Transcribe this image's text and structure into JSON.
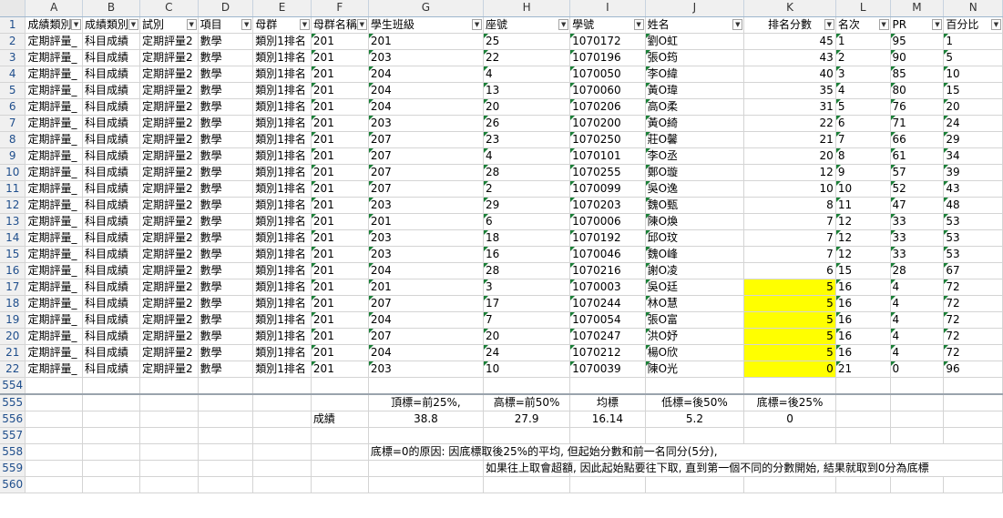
{
  "column_letters": [
    "A",
    "B",
    "C",
    "D",
    "E",
    "F",
    "G",
    "H",
    "I",
    "J",
    "K",
    "L",
    "M",
    "N"
  ],
  "headers": [
    "成績類別",
    "成績類別",
    "試別",
    "項目",
    "母群",
    "母群名稱",
    "學生班級",
    "座號",
    "學號",
    "姓名",
    "排名分數",
    "名次",
    "PR",
    "百分比"
  ],
  "rows": [
    {
      "n": "2",
      "a": "定期評量_",
      "b": "科目成績",
      "c": "定期評量2",
      "d": "數學",
      "e": "類別1排名",
      "f": "201",
      "g": "201",
      "h": "25",
      "i": "1070172",
      "j": "劉O虹",
      "k": "45",
      "l": "1",
      "m": "95",
      "o": "1",
      "hl": false
    },
    {
      "n": "3",
      "a": "定期評量_",
      "b": "科目成績",
      "c": "定期評量2",
      "d": "數學",
      "e": "類別1排名",
      "f": "201",
      "g": "203",
      "h": "22",
      "i": "1070196",
      "j": "張O筠",
      "k": "43",
      "l": "2",
      "m": "90",
      "o": "5",
      "hl": false
    },
    {
      "n": "4",
      "a": "定期評量_",
      "b": "科目成績",
      "c": "定期評量2",
      "d": "數學",
      "e": "類別1排名",
      "f": "201",
      "g": "204",
      "h": "4",
      "i": "1070050",
      "j": "李O緯",
      "k": "40",
      "l": "3",
      "m": "85",
      "o": "10",
      "hl": false
    },
    {
      "n": "5",
      "a": "定期評量_",
      "b": "科目成績",
      "c": "定期評量2",
      "d": "數學",
      "e": "類別1排名",
      "f": "201",
      "g": "204",
      "h": "13",
      "i": "1070060",
      "j": "黃O瑋",
      "k": "35",
      "l": "4",
      "m": "80",
      "o": "15",
      "hl": false
    },
    {
      "n": "6",
      "a": "定期評量_",
      "b": "科目成績",
      "c": "定期評量2",
      "d": "數學",
      "e": "類別1排名",
      "f": "201",
      "g": "204",
      "h": "20",
      "i": "1070206",
      "j": "高O柔",
      "k": "31",
      "l": "5",
      "m": "76",
      "o": "20",
      "hl": false
    },
    {
      "n": "7",
      "a": "定期評量_",
      "b": "科目成績",
      "c": "定期評量2",
      "d": "數學",
      "e": "類別1排名",
      "f": "201",
      "g": "203",
      "h": "26",
      "i": "1070200",
      "j": "黃O綺",
      "k": "22",
      "l": "6",
      "m": "71",
      "o": "24",
      "hl": false
    },
    {
      "n": "8",
      "a": "定期評量_",
      "b": "科目成績",
      "c": "定期評量2",
      "d": "數學",
      "e": "類別1排名",
      "f": "201",
      "g": "207",
      "h": "23",
      "i": "1070250",
      "j": "莊O馨",
      "k": "21",
      "l": "7",
      "m": "66",
      "o": "29",
      "hl": false
    },
    {
      "n": "9",
      "a": "定期評量_",
      "b": "科目成績",
      "c": "定期評量2",
      "d": "數學",
      "e": "類別1排名",
      "f": "201",
      "g": "207",
      "h": "4",
      "i": "1070101",
      "j": "李O丞",
      "k": "20",
      "l": "8",
      "m": "61",
      "o": "34",
      "hl": false
    },
    {
      "n": "10",
      "a": "定期評量_",
      "b": "科目成績",
      "c": "定期評量2",
      "d": "數學",
      "e": "類別1排名",
      "f": "201",
      "g": "207",
      "h": "28",
      "i": "1070255",
      "j": "鄭O璇",
      "k": "12",
      "l": "9",
      "m": "57",
      "o": "39",
      "hl": false
    },
    {
      "n": "11",
      "a": "定期評量_",
      "b": "科目成績",
      "c": "定期評量2",
      "d": "數學",
      "e": "類別1排名",
      "f": "201",
      "g": "207",
      "h": "2",
      "i": "1070099",
      "j": "吳O逸",
      "k": "10",
      "l": "10",
      "m": "52",
      "o": "43",
      "hl": false
    },
    {
      "n": "12",
      "a": "定期評量_",
      "b": "科目成績",
      "c": "定期評量2",
      "d": "數學",
      "e": "類別1排名",
      "f": "201",
      "g": "203",
      "h": "29",
      "i": "1070203",
      "j": "魏O甄",
      "k": "8",
      "l": "11",
      "m": "47",
      "o": "48",
      "hl": false
    },
    {
      "n": "13",
      "a": "定期評量_",
      "b": "科目成績",
      "c": "定期評量2",
      "d": "數學",
      "e": "類別1排名",
      "f": "201",
      "g": "201",
      "h": "6",
      "i": "1070006",
      "j": "陳O煥",
      "k": "7",
      "l": "12",
      "m": "33",
      "o": "53",
      "hl": false
    },
    {
      "n": "14",
      "a": "定期評量_",
      "b": "科目成績",
      "c": "定期評量2",
      "d": "數學",
      "e": "類別1排名",
      "f": "201",
      "g": "203",
      "h": "18",
      "i": "1070192",
      "j": "邱O玟",
      "k": "7",
      "l": "12",
      "m": "33",
      "o": "53",
      "hl": false
    },
    {
      "n": "15",
      "a": "定期評量_",
      "b": "科目成績",
      "c": "定期評量2",
      "d": "數學",
      "e": "類別1排名",
      "f": "201",
      "g": "203",
      "h": "16",
      "i": "1070046",
      "j": "魏O峰",
      "k": "7",
      "l": "12",
      "m": "33",
      "o": "53",
      "hl": false
    },
    {
      "n": "16",
      "a": "定期評量_",
      "b": "科目成績",
      "c": "定期評量2",
      "d": "數學",
      "e": "類別1排名",
      "f": "201",
      "g": "204",
      "h": "28",
      "i": "1070216",
      "j": "謝O凌",
      "k": "6",
      "l": "15",
      "m": "28",
      "o": "67",
      "hl": false
    },
    {
      "n": "17",
      "a": "定期評量_",
      "b": "科目成績",
      "c": "定期評量2",
      "d": "數學",
      "e": "類別1排名",
      "f": "201",
      "g": "201",
      "h": "3",
      "i": "1070003",
      "j": "吳O廷",
      "k": "5",
      "l": "16",
      "m": "4",
      "o": "72",
      "hl": true
    },
    {
      "n": "18",
      "a": "定期評量_",
      "b": "科目成績",
      "c": "定期評量2",
      "d": "數學",
      "e": "類別1排名",
      "f": "201",
      "g": "207",
      "h": "17",
      "i": "1070244",
      "j": "林O慧",
      "k": "5",
      "l": "16",
      "m": "4",
      "o": "72",
      "hl": true
    },
    {
      "n": "19",
      "a": "定期評量_",
      "b": "科目成績",
      "c": "定期評量2",
      "d": "數學",
      "e": "類別1排名",
      "f": "201",
      "g": "204",
      "h": "7",
      "i": "1070054",
      "j": "張O富",
      "k": "5",
      "l": "16",
      "m": "4",
      "o": "72",
      "hl": true
    },
    {
      "n": "20",
      "a": "定期評量_",
      "b": "科目成績",
      "c": "定期評量2",
      "d": "數學",
      "e": "類別1排名",
      "f": "201",
      "g": "207",
      "h": "20",
      "i": "1070247",
      "j": "洪O妤",
      "k": "5",
      "l": "16",
      "m": "4",
      "o": "72",
      "hl": true
    },
    {
      "n": "21",
      "a": "定期評量_",
      "b": "科目成績",
      "c": "定期評量2",
      "d": "數學",
      "e": "類別1排名",
      "f": "201",
      "g": "204",
      "h": "24",
      "i": "1070212",
      "j": "楊O欣",
      "k": "5",
      "l": "16",
      "m": "4",
      "o": "72",
      "hl": true
    },
    {
      "n": "22",
      "a": "定期評量_",
      "b": "科目成績",
      "c": "定期評量2",
      "d": "數學",
      "e": "類別1排名",
      "f": "201",
      "g": "203",
      "h": "10",
      "i": "1070039",
      "j": "陳O光",
      "k": "0",
      "l": "21",
      "m": "0",
      "o": "96",
      "hl": true
    }
  ],
  "bottom_rows": [
    "554",
    "555",
    "556",
    "557",
    "558",
    "559",
    "560"
  ],
  "stats": {
    "labels": [
      "頂標=前25%,",
      "高標=前50%",
      "均標",
      "低標=後50%",
      "底標=後25%"
    ],
    "row_label": "成績",
    "values": [
      "38.8",
      "27.9",
      "16.14",
      "5.2",
      "0"
    ]
  },
  "note_line1": "底標=0的原因: 因底標取後25%的平均, 但起始分數和前一名同分(5分),",
  "note_line2": "如果往上取會超額, 因此起始點要往下取, 直到第一個不同的分數開始, 結果就取到0分為底標",
  "colors": {
    "highlight": "#ffff00",
    "header_bg": "#f0f0f0",
    "gridline": "#d4d4d4",
    "comment_marker": "#1a7f37"
  }
}
